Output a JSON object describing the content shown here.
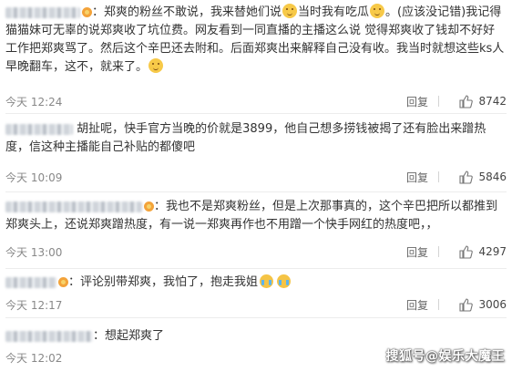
{
  "comments": [
    {
      "text_a": "郑爽的粉丝不敢说，我来替她们说",
      "text_b": "当时我有吃瓜",
      "text_c": "。(应该没记错)我记得猫猫妹可无辜的说郑爽收了坑位费。网友看到一同直播的主播这么说 觉得郑爽收了钱却不好好工作把郑爽骂了。然后这个辛巴还去附和。后面郑爽出来解释自己没有收。我当时就想这些ks人早晚翻车，这不，就来了。",
      "time": "今天 12:24",
      "reply": "回复",
      "likes": "8742"
    },
    {
      "text": "胡扯呢，快手官方当晚的价就是3899，他自己想多捞钱被揭了还有脸出来蹭热度，信这种主播能自己补贴的都傻吧",
      "time": "今天 10:09",
      "reply": "回复",
      "likes": "5846"
    },
    {
      "text": "我也不是郑爽粉丝，但是上次那事真的，这个辛巴把所以都推到郑爽头上，还说郑爽蹭热度，有一说一郑爽再作也不用蹭一个快手网红的热度吧，，",
      "time": "今天 13:00",
      "reply": "回复",
      "likes": "4297"
    },
    {
      "text": "评论别带郑爽，我怕了，抱走我姐",
      "time": "今天 12:17",
      "reply": "回复",
      "likes": "3006"
    },
    {
      "text": "想起郑爽了",
      "time": "今天 12:02"
    }
  ],
  "watermark": "搜狐号@娱乐大魔王",
  "colors": {
    "text": "#333333",
    "meta": "#888888",
    "divider": "#ececec"
  }
}
